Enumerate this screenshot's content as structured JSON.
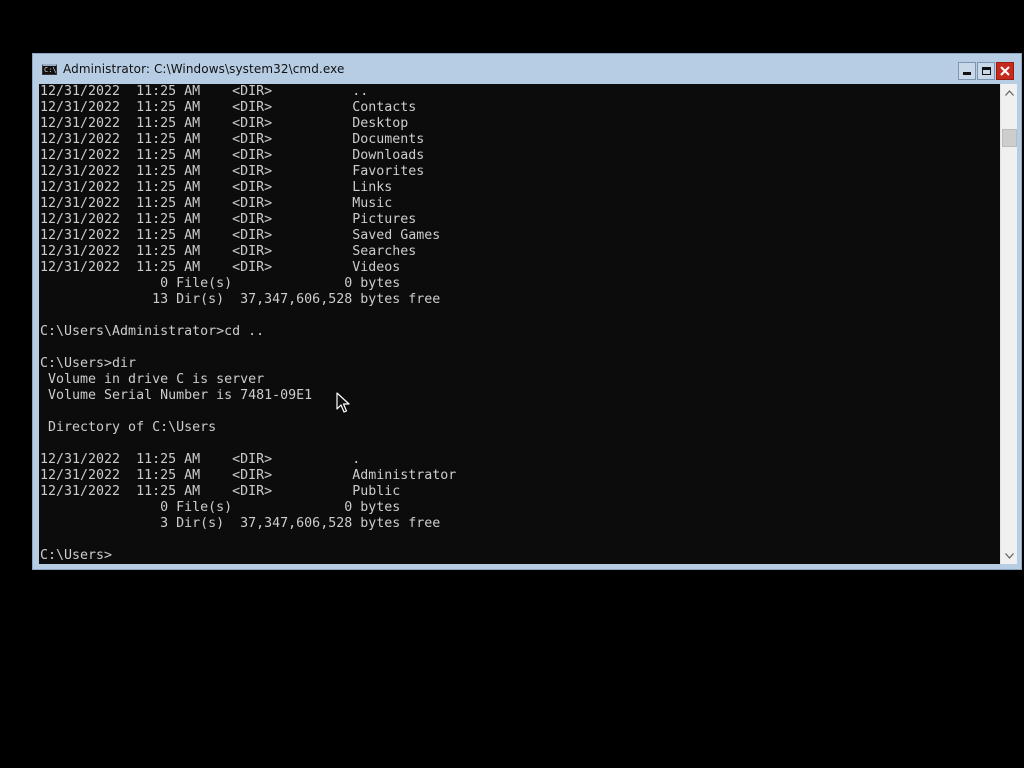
{
  "window": {
    "title": "Administrator: C:\\Windows\\system32\\cmd.exe",
    "icon": "cmd-icon",
    "icon_text": "C:\\",
    "controls": [
      "minimize-icon",
      "maximize-icon",
      "close-icon"
    ],
    "title_bar_color": "#b6cde4",
    "close_color": "#c42b1c"
  },
  "console": {
    "background": "#0c0c0c",
    "foreground": "#cccccc",
    "lines": [
      "12/31/2022  11:25 AM    <DIR>          ..",
      "12/31/2022  11:25 AM    <DIR>          Contacts",
      "12/31/2022  11:25 AM    <DIR>          Desktop",
      "12/31/2022  11:25 AM    <DIR>          Documents",
      "12/31/2022  11:25 AM    <DIR>          Downloads",
      "12/31/2022  11:25 AM    <DIR>          Favorites",
      "12/31/2022  11:25 AM    <DIR>          Links",
      "12/31/2022  11:25 AM    <DIR>          Music",
      "12/31/2022  11:25 AM    <DIR>          Pictures",
      "12/31/2022  11:25 AM    <DIR>          Saved Games",
      "12/31/2022  11:25 AM    <DIR>          Searches",
      "12/31/2022  11:25 AM    <DIR>          Videos",
      "               0 File(s)              0 bytes",
      "              13 Dir(s)  37,347,606,528 bytes free",
      "",
      "C:\\Users\\Administrator>cd ..",
      "",
      "C:\\Users>dir",
      " Volume in drive C is server",
      " Volume Serial Number is 7481-09E1",
      "",
      " Directory of C:\\Users",
      "",
      "12/31/2022  11:25 AM    <DIR>          .",
      "12/31/2022  11:25 AM    <DIR>          Administrator",
      "12/31/2022  11:25 AM    <DIR>          Public",
      "               0 File(s)              0 bytes",
      "               3 Dir(s)  37,347,606,528 bytes free",
      "",
      "C:\\Users>"
    ]
  },
  "scrollbar": {
    "up_icon": "scroll-up-arrow-icon",
    "down_icon": "scroll-down-arrow-icon"
  }
}
